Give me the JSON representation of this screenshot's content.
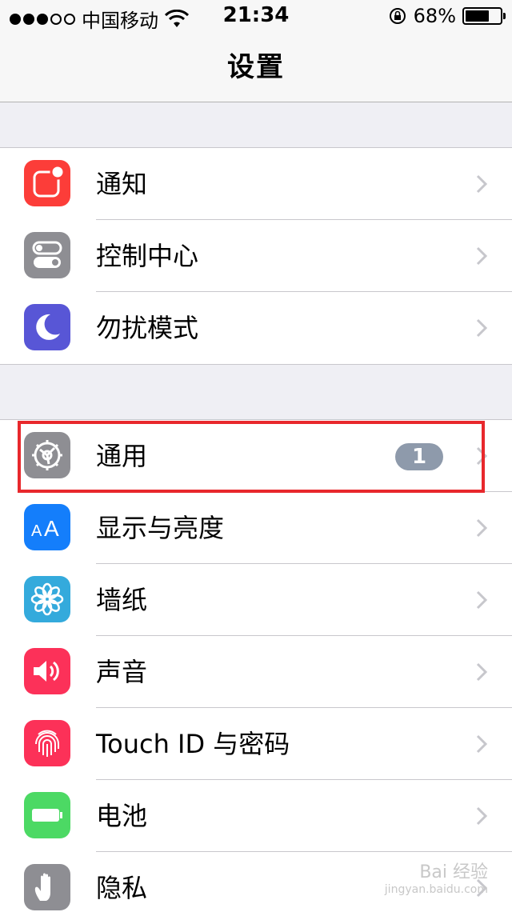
{
  "status_bar": {
    "carrier": "中国移动",
    "time": "21:34",
    "battery_percent": "68%",
    "battery_level": 0.68,
    "signal_bars": 3,
    "signal_total": 5
  },
  "nav": {
    "title": "设置"
  },
  "groups": [
    {
      "items": [
        {
          "label": "通知",
          "icon": "notifications-icon",
          "icon_color": "#fc3d39"
        },
        {
          "label": "控制中心",
          "icon": "control-center-icon",
          "icon_color": "#8e8e93"
        },
        {
          "label": "勿扰模式",
          "icon": "moon-icon",
          "icon_color": "#5856d6"
        }
      ]
    },
    {
      "items": [
        {
          "label": "通用",
          "icon": "gear-icon",
          "icon_color": "#8e8e93",
          "badge": "1"
        },
        {
          "label": "显示与亮度",
          "icon": "display-brightness-icon",
          "icon_color": "#147efb"
        },
        {
          "label": "墙纸",
          "icon": "wallpaper-flower-icon",
          "icon_color": "#34aadc"
        },
        {
          "label": "声音",
          "icon": "speaker-icon",
          "icon_color": "#fc3159"
        },
        {
          "label": "Touch ID 与密码",
          "icon": "fingerprint-icon",
          "icon_color": "#fc3158"
        },
        {
          "label": "电池",
          "icon": "battery-icon",
          "icon_color": "#4cd964"
        },
        {
          "label": "隐私",
          "icon": "hand-icon",
          "icon_color": "#8e8e93"
        }
      ]
    }
  ],
  "watermark": {
    "main": "Bai 经验",
    "sub": "jingyan.baidu.com"
  }
}
